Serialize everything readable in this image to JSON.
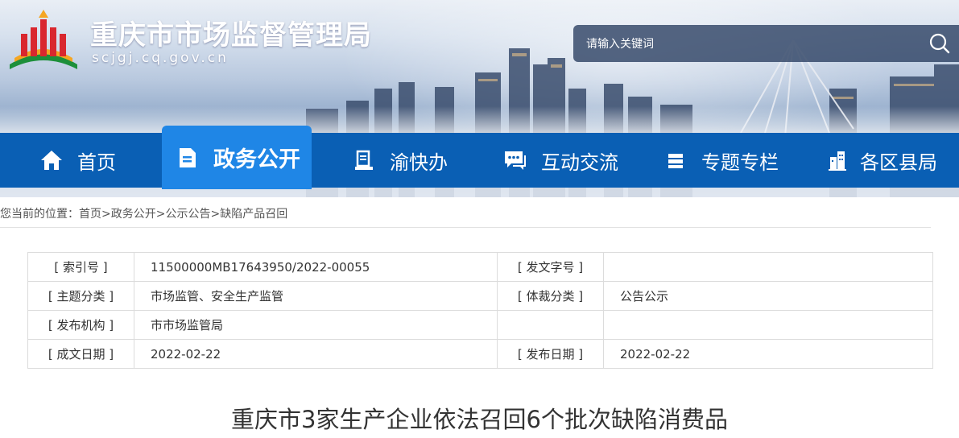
{
  "header": {
    "site_title": "重庆市市场监督管理局",
    "site_domain": "scjgj.cq.gov.cn",
    "search_placeholder": "请输入关键词"
  },
  "nav": {
    "items": [
      {
        "label": "首页",
        "icon": "home-icon",
        "active": false
      },
      {
        "label": "政务公开",
        "icon": "document-icon",
        "active": true
      },
      {
        "label": "渝快办",
        "icon": "service-icon",
        "active": false
      },
      {
        "label": "互动交流",
        "icon": "chat-icon",
        "active": false
      },
      {
        "label": "专题专栏",
        "icon": "topic-icon",
        "active": false
      },
      {
        "label": "各区县局",
        "icon": "building-icon",
        "active": false
      }
    ]
  },
  "breadcrumb": {
    "prefix": "您当前的位置：",
    "items": [
      "首页",
      "政务公开",
      "公示公告",
      "缺陷产品召回"
    ],
    "separator": ">"
  },
  "meta_table": {
    "rows": [
      {
        "label1": "[ 索引号 ]",
        "value1": "11500000MB17643950/2022-00055",
        "label2": "[ 发文字号 ]",
        "value2": ""
      },
      {
        "label1": "[ 主题分类 ]",
        "value1": "市场监管、安全生产监管",
        "label2": "[ 体裁分类 ]",
        "value2": "公告公示"
      },
      {
        "label1": "[ 发布机构 ]",
        "value1": "市市场监管局",
        "label2": "",
        "value2": ""
      },
      {
        "label1": "[ 成文日期 ]",
        "value1": "2022-02-22",
        "label2": "[ 发布日期 ]",
        "value2": "2022-02-22"
      }
    ]
  },
  "article": {
    "title": "重庆市3家生产企业依法召回6个批次缺陷消费品"
  },
  "colors": {
    "nav_bg": "#0a5fb4",
    "nav_active": "#1f86e6",
    "text": "#333333"
  }
}
